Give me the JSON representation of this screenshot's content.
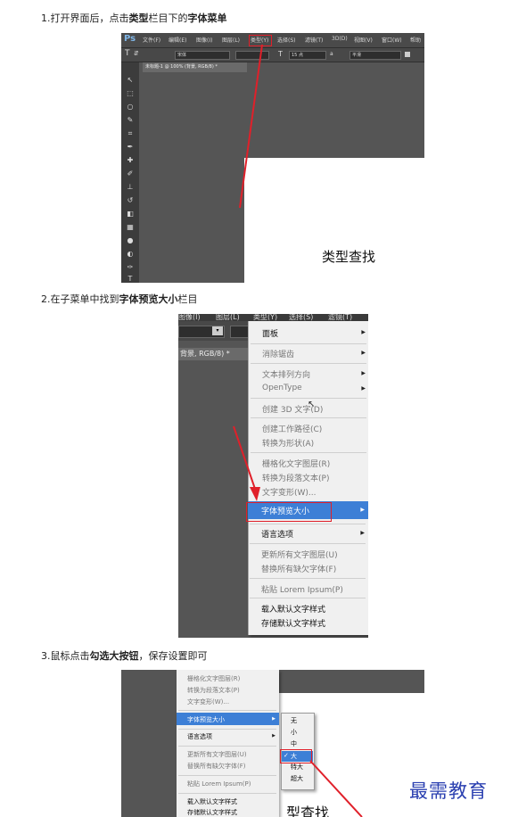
{
  "steps": [
    {
      "prefix": "1.打开界面后，点击",
      "bold1": "类型",
      "middle": "栏目下的",
      "bold2": "字体菜单",
      "suffix": ""
    },
    {
      "prefix": "2.在子菜单中找到",
      "bold1": "字体预览大小",
      "middle": "栏目",
      "bold2": "",
      "suffix": ""
    },
    {
      "prefix": "3.鼠标点击",
      "bold1": "勾选大按钮",
      "middle": "，保存设置即可",
      "bold2": "",
      "suffix": ""
    }
  ],
  "shot1": {
    "logo": "Ps",
    "menu": [
      "文件(F)",
      "编辑(E)",
      "图像(I)",
      "图层(L)",
      "类型(Y)",
      "选择(S)",
      "滤镜(T)",
      "3D(D)",
      "视图(V)",
      "窗口(W)",
      "帮助"
    ],
    "font_name": "宋体",
    "font_size": "15 点",
    "aa_mode": "平滑",
    "doc_tab": "未标题-1 @ 100% (背景, RGB/8) *",
    "caption": "类型查找"
  },
  "shot2": {
    "top_items": [
      "图像(I)",
      "图层(L)",
      "类型(Y)",
      "选择(S)",
      "滤镜(T)"
    ],
    "doc_tab": "背景, RGB/8) *",
    "menu": [
      {
        "label": "面板",
        "enabled": true,
        "submenu": true
      },
      {
        "label": "消除锯齿",
        "enabled": false,
        "submenu": true
      },
      {
        "label": "文本排列方向",
        "enabled": false,
        "submenu": true
      },
      {
        "label": "OpenType",
        "enabled": false,
        "submenu": true
      },
      {
        "label": "创建 3D 文字(D)",
        "enabled": false,
        "submenu": false
      },
      {
        "label": "创建工作路径(C)",
        "enabled": false,
        "submenu": false
      },
      {
        "label": "转换为形状(A)",
        "enabled": false,
        "submenu": false
      },
      {
        "label": "栅格化文字图层(R)",
        "enabled": false,
        "submenu": false
      },
      {
        "label": "转换为段落文本(P)",
        "enabled": false,
        "submenu": false
      },
      {
        "label": "文字变形(W)...",
        "enabled": false,
        "submenu": false
      },
      {
        "label": "字体预览大小",
        "enabled": true,
        "submenu": true,
        "selected": true
      },
      {
        "label": "语言选项",
        "enabled": true,
        "submenu": true
      },
      {
        "label": "更新所有文字图层(U)",
        "enabled": false,
        "submenu": false
      },
      {
        "label": "替换所有缺欠字体(F)",
        "enabled": false,
        "submenu": false
      },
      {
        "label": "粘贴 Lorem Ipsum(P)",
        "enabled": false,
        "submenu": false
      },
      {
        "label": "载入默认文字样式",
        "enabled": true,
        "submenu": false
      },
      {
        "label": "存储默认文字样式",
        "enabled": true,
        "submenu": false
      }
    ]
  },
  "shot3": {
    "menu": [
      {
        "label": "栅格化文字图层(R)",
        "enabled": false
      },
      {
        "label": "转换为段落文本(P)",
        "enabled": false
      },
      {
        "label": "文字变形(W)...",
        "enabled": false
      },
      {
        "label": "字体预览大小",
        "enabled": true,
        "selected": true
      },
      {
        "label": "语言选项",
        "enabled": true
      },
      {
        "label": "更新所有文字图层(U)",
        "enabled": false
      },
      {
        "label": "替换所有缺欠字体(F)",
        "enabled": false
      },
      {
        "label": "粘贴 Lorem Ipsum(P)",
        "enabled": false
      },
      {
        "label": "载入默认文字样式",
        "enabled": true
      },
      {
        "label": "存储默认文字样式",
        "enabled": true
      }
    ],
    "submenu": [
      "无",
      "小",
      "中",
      "大",
      "特大",
      "超大"
    ],
    "checked": "大",
    "checkmark": "✓",
    "caption": "型查找"
  },
  "watermark": "最需教育",
  "colors": {
    "highlight": "#e0202a",
    "selection": "#3d7fd6",
    "ps_dark": "#555555",
    "watermark": "#2a3fb0"
  }
}
